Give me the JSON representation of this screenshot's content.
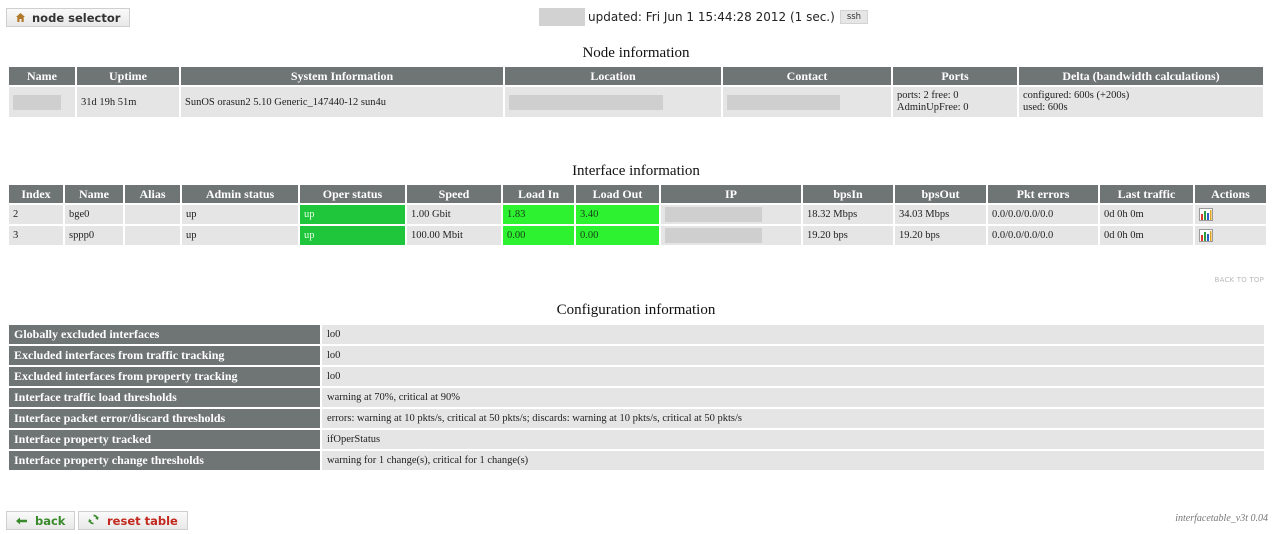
{
  "header": {
    "node_selector_label": "node selector",
    "updated_text": "updated: Fri Jun 1 15:44:28 2012 (1 sec.)",
    "ssh_label": "ssh"
  },
  "node_info": {
    "title": "Node information",
    "columns": [
      "Name",
      "Uptime",
      "System Information",
      "Location",
      "Contact",
      "Ports",
      "Delta (bandwidth calculations)"
    ],
    "uptime": "31d 19h 51m",
    "system_information": "SunOS orasun2 5.10 Generic_147440-12 sun4u",
    "ports_line1": "ports: 2 free: 0",
    "ports_line2": "AdminUpFree: 0",
    "delta_line1": "configured: 600s (+200s)",
    "delta_line2": "used: 600s"
  },
  "interface_info": {
    "title": "Interface information",
    "columns": [
      "Index",
      "Name",
      "Alias",
      "Admin status",
      "Oper status",
      "Speed",
      "Load In",
      "Load Out",
      "IP",
      "bpsIn",
      "bpsOut",
      "Pkt errors",
      "Last traffic",
      "Actions"
    ],
    "rows": [
      {
        "index": "2",
        "name": "bge0",
        "alias": "",
        "admin": "up",
        "oper": "up",
        "speed": "1.00 Gbit",
        "load_in": "1.83",
        "load_out": "3.40",
        "bps_in": "18.32 Mbps",
        "bps_out": "34.03 Mbps",
        "pkt_errors": "0.0/0.0/0.0/0.0",
        "last_traffic": "0d 0h 0m",
        "action_icon": "bar-chart-icon"
      },
      {
        "index": "3",
        "name": "sppp0",
        "alias": "",
        "admin": "up",
        "oper": "up",
        "speed": "100.00 Mbit",
        "load_in": "0.00",
        "load_out": "0.00",
        "bps_in": "19.20 bps",
        "bps_out": "19.20 bps",
        "pkt_errors": "0.0/0.0/0.0/0.0",
        "last_traffic": "0d 0h 0m",
        "action_icon": "bar-chart-icon"
      }
    ]
  },
  "back_to_top": "BACK TO TOP",
  "config_info": {
    "title": "Configuration information",
    "rows": [
      {
        "label": "Globally excluded interfaces",
        "value": "lo0"
      },
      {
        "label": "Excluded interfaces from traffic tracking",
        "value": "lo0"
      },
      {
        "label": "Excluded interfaces from property tracking",
        "value": "lo0"
      },
      {
        "label": "Interface traffic load thresholds",
        "value": "warning at 70%, critical at 90%"
      },
      {
        "label": "Interface packet error/discard thresholds",
        "value": "errors: warning at 10 pkts/s, critical at 50 pkts/s; discards: warning at 10 pkts/s, critical at 50 pkts/s"
      },
      {
        "label": "Interface property tracked",
        "value": "ifOperStatus"
      },
      {
        "label": "Interface property change thresholds",
        "value": "warning for 1 change(s), critical for 1 change(s)"
      }
    ]
  },
  "footer": {
    "back_label": "back",
    "reset_label": "reset table",
    "version": "interfacetable_v3t 0.04"
  },
  "colors": {
    "header_bg": "#6f7474",
    "cell_bg": "#e5e5e5",
    "oper_up": "#1fc53a",
    "load_ok": "#2cf22f"
  }
}
